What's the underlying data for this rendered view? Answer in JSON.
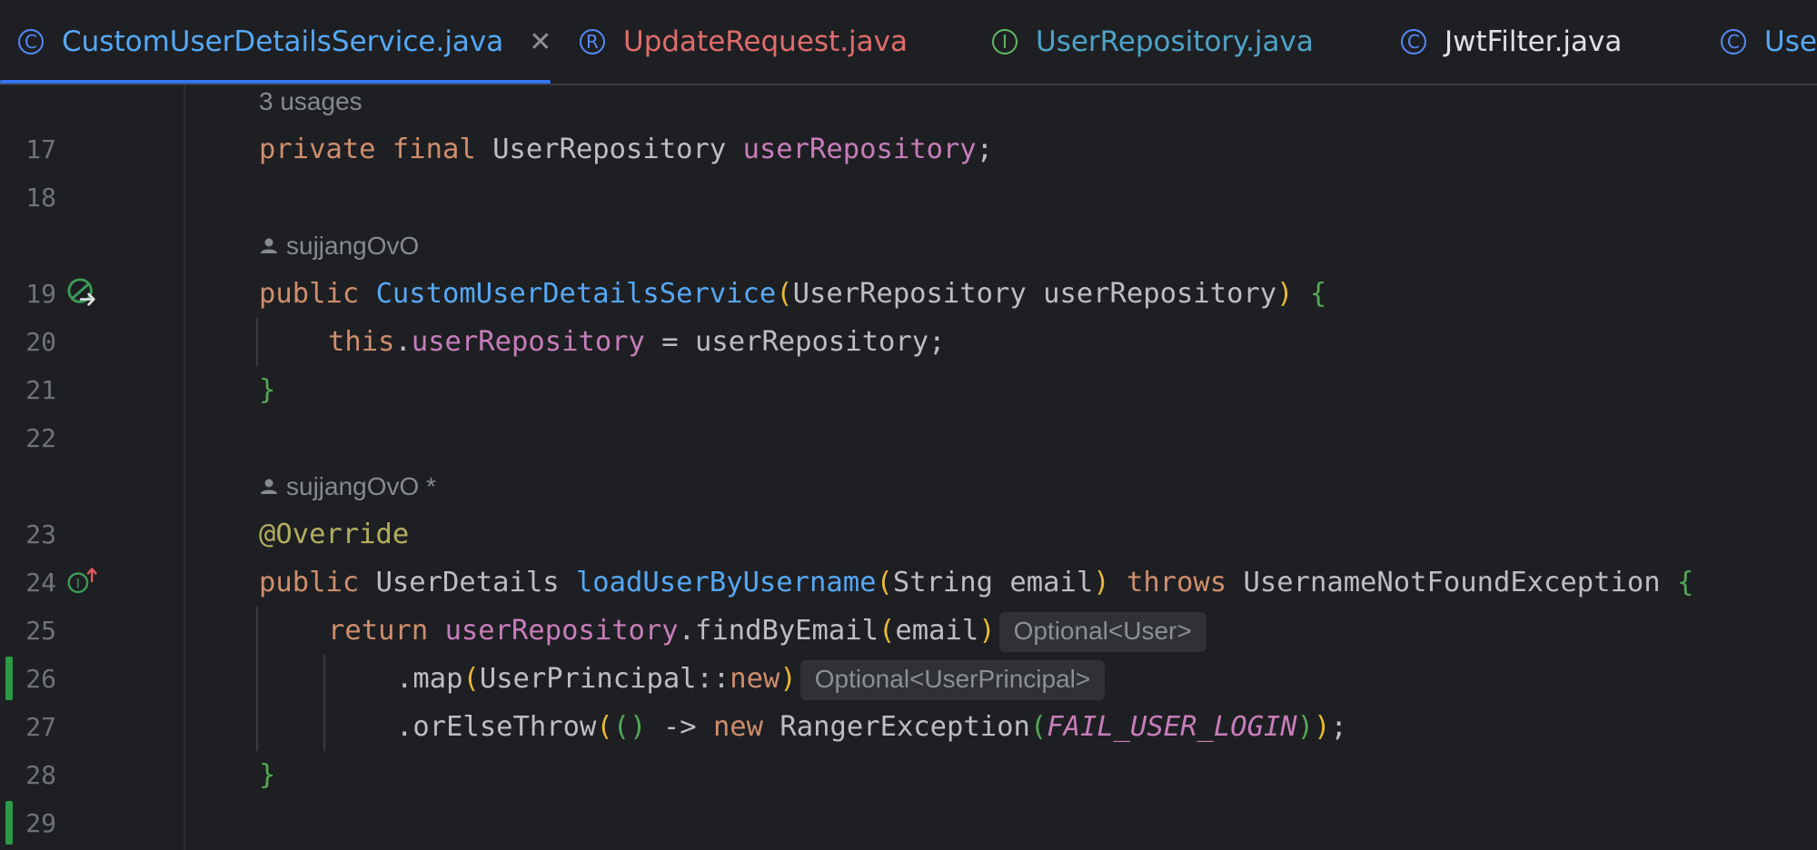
{
  "tabs": [
    {
      "label": "CustomUserDetailsService.java",
      "kind": "C",
      "color": "#56a8f5",
      "active": true,
      "closable": true
    },
    {
      "label": "UpdateRequest.java",
      "kind": "R",
      "color": "#e06c6c"
    },
    {
      "label": "UserRepository.java",
      "kind": "I",
      "color": "#4ea3c8"
    },
    {
      "label": "JwtFilter.java",
      "kind": "C",
      "color": "#dfe1e5"
    },
    {
      "label": "User",
      "kind": "C",
      "color": "#56a8f5"
    }
  ],
  "close_glyph": "✕",
  "editor": {
    "hints": {
      "usages": "3 usages",
      "author1": "sujjangOvO",
      "author2": "sujjangOvO *"
    },
    "line_numbers": [
      "17",
      "18",
      "19",
      "20",
      "21",
      "22",
      "23",
      "24",
      "25",
      "26",
      "27",
      "28",
      "29"
    ],
    "inlays": {
      "optional_user": "Optional<User>",
      "optional_principal": "Optional<UserPrincipal>"
    },
    "code": {
      "l17": {
        "kw1": "private",
        "kw2": "final",
        "type": "UserRepository",
        "field": "userRepository",
        "end": ";"
      },
      "l19": {
        "kw": "public",
        "fn": "CustomUserDetailsService",
        "lp": "(",
        "params": "UserRepository userRepository",
        "rp": ")",
        "brace": "{"
      },
      "l20": {
        "kw": "this",
        "dot": ".",
        "field": "userRepository",
        "rest": " = userRepository;"
      },
      "l21": {
        "brace": "}"
      },
      "l23": {
        "ann": "@Override"
      },
      "l24": {
        "kw": "public",
        "type": "UserDetails",
        "fn": "loadUserByUsername",
        "lp": "(",
        "params": "String email",
        "rp": ")",
        "throws": "throws",
        "exc": "UsernameNotFoundException",
        "brace": "{"
      },
      "l25": {
        "kw": "return",
        "field": "userRepository",
        "call": ".findByEmail",
        "lp": "(",
        "arg": "email",
        "rp": ")"
      },
      "l26": {
        "call": ".map",
        "lp": "(",
        "ref": "UserPrincipal::",
        "kwnew": "new",
        "rp": ")"
      },
      "l27": {
        "call": ".orElseThrow",
        "lp": "(",
        "lam1": "(",
        "lam2": ")",
        "arrow": " -> ",
        "kwnew": "new",
        "type": "RangerException",
        "lp2": "(",
        "const": "FAIL_USER_LOGIN",
        "rp2": ")",
        "rp": ")",
        "end": ";"
      },
      "l28": {
        "brace": "}"
      }
    }
  }
}
